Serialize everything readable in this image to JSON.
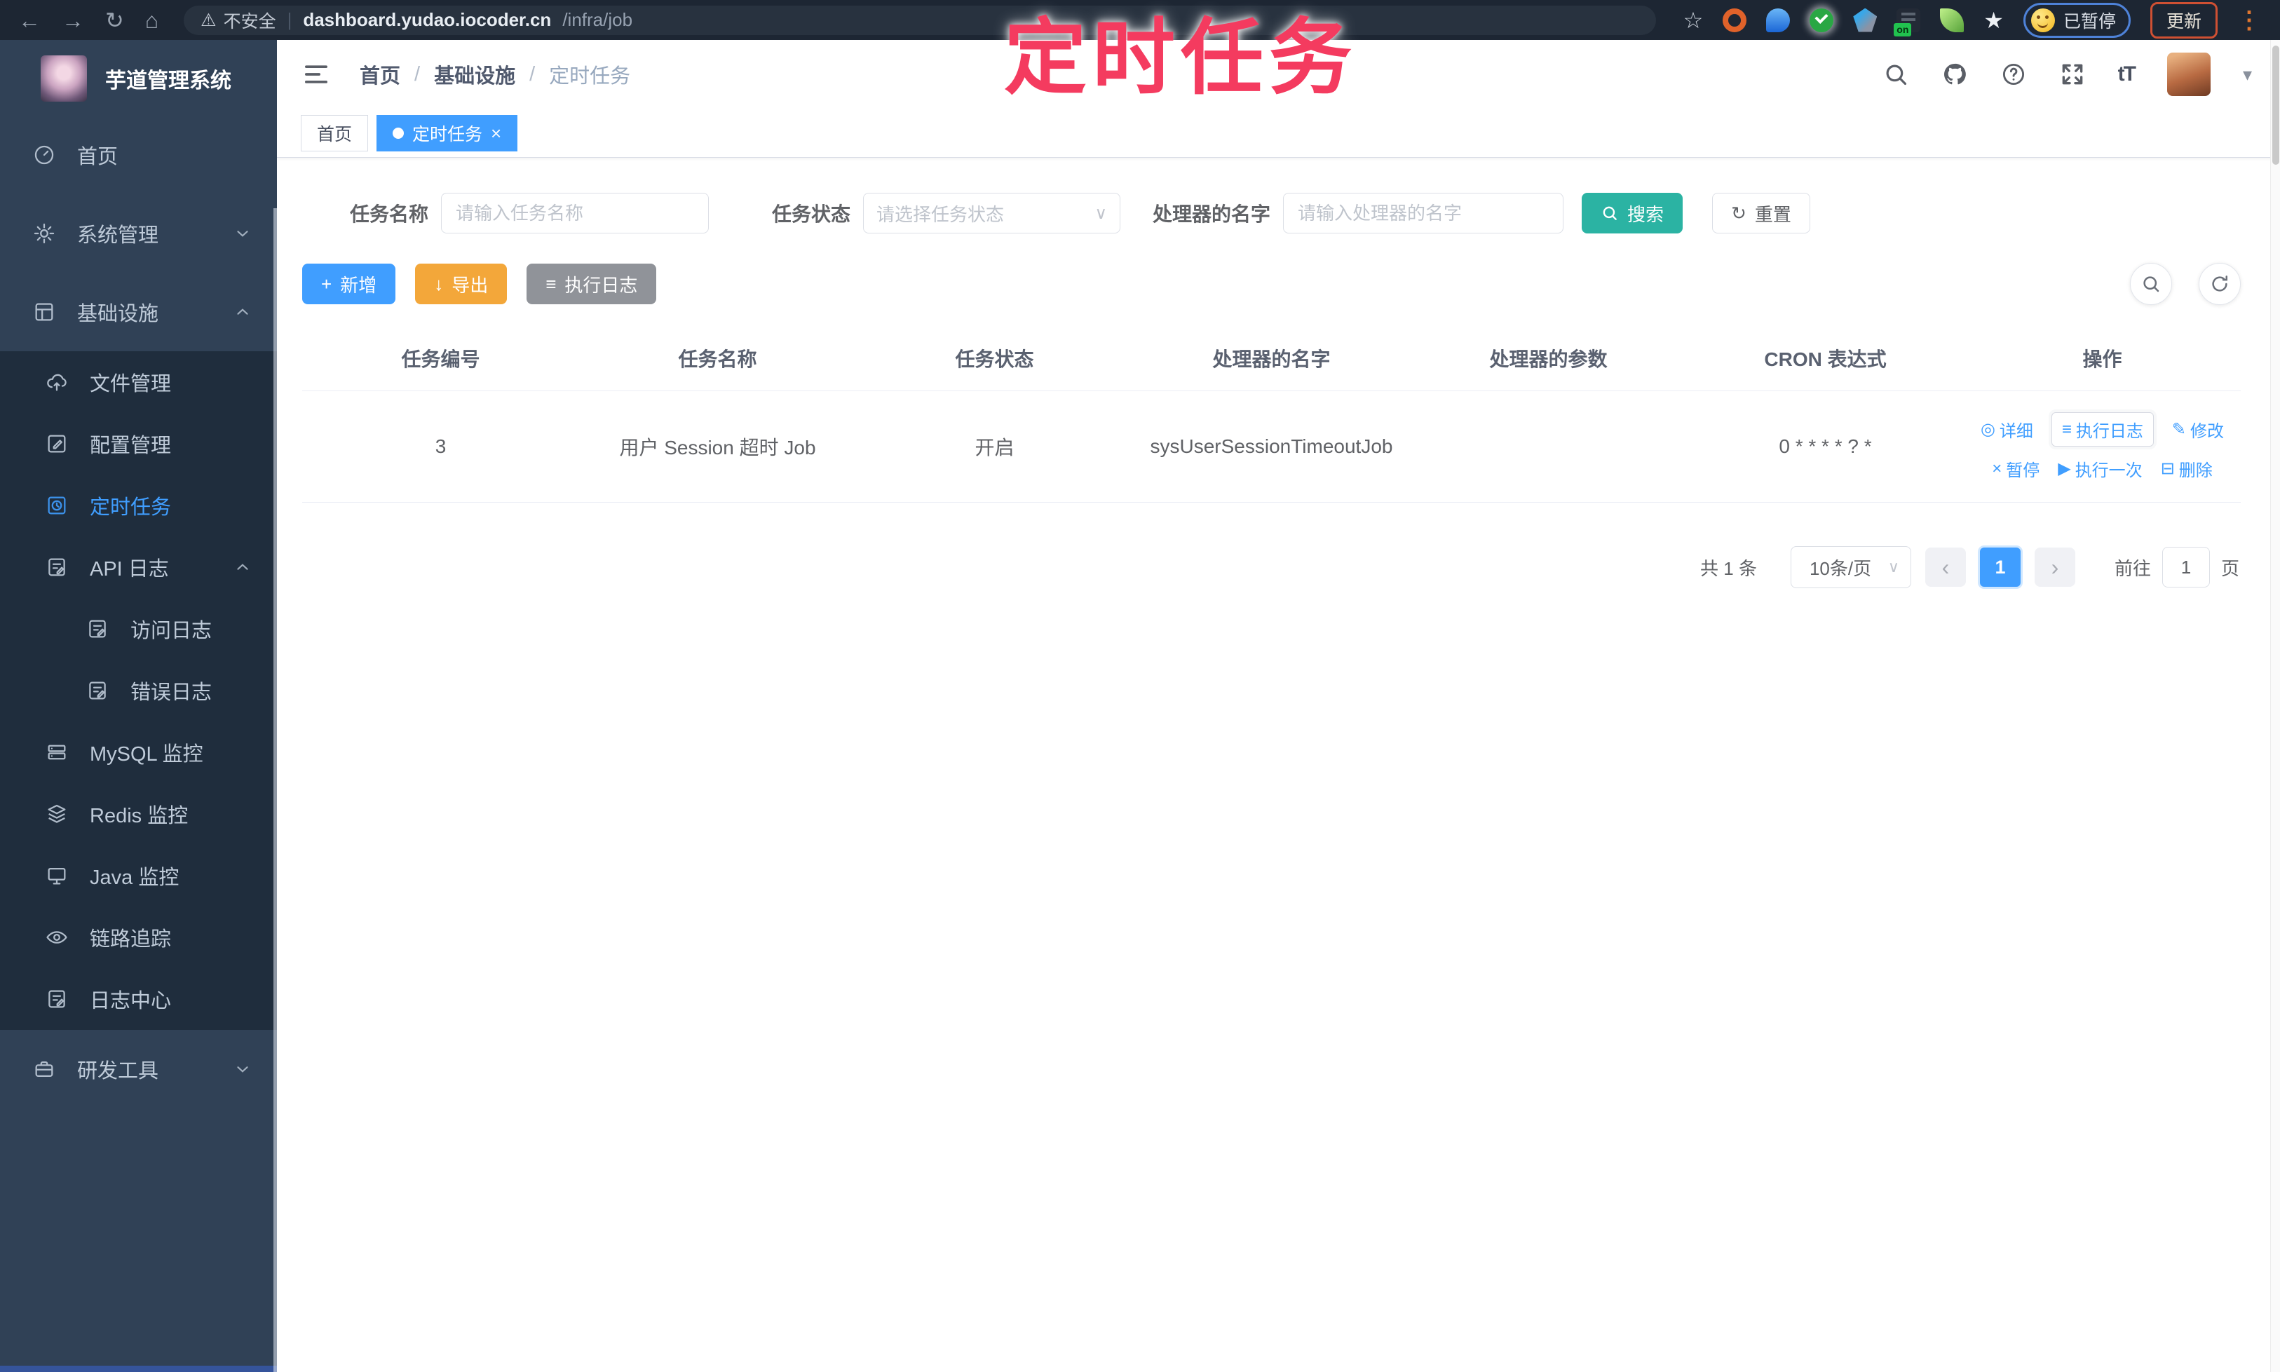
{
  "glyphs": {
    "back": "←",
    "forward": "→",
    "reload": "↻",
    "home": "⌂",
    "warning": "⚠",
    "bookmark_star": "☆",
    "star_filled": "★",
    "overflow_dots": "⋮",
    "url_divider": "|",
    "caret_down": "▾",
    "tab_close": "×",
    "select_chevron": "∨",
    "prev": "‹",
    "next": "›",
    "plus": "+",
    "download": "↓",
    "list": "≡",
    "reset": "↻",
    "font_size": "tT",
    "action_detail": "◎",
    "action_log": "≡",
    "action_edit": "✎",
    "action_pause": "×",
    "action_run": "▶",
    "action_delete": "⊟",
    "onoff_badge": "on"
  },
  "browser": {
    "security_label": "不安全",
    "url_host": "dashboard.yudao.iocoder.cn",
    "url_path": "/infra/job",
    "paused_label": "已暂停",
    "update_label": "更新"
  },
  "annotation": {
    "text": "定时任务",
    "color": "#f43b5f"
  },
  "sidebar": {
    "title": "芋道管理系统",
    "items": [
      {
        "label": "首页"
      },
      {
        "label": "系统管理"
      },
      {
        "label": "基础设施"
      },
      {
        "label": "文件管理"
      },
      {
        "label": "配置管理"
      },
      {
        "label": "定时任务"
      },
      {
        "label": "API 日志"
      },
      {
        "label": "访问日志"
      },
      {
        "label": "错误日志"
      },
      {
        "label": "MySQL 监控"
      },
      {
        "label": "Redis 监控"
      },
      {
        "label": "Java 监控"
      },
      {
        "label": "链路追踪"
      },
      {
        "label": "日志中心"
      },
      {
        "label": "研发工具"
      }
    ]
  },
  "header": {
    "breadcrumb": [
      "首页",
      "基础设施",
      "定时任务"
    ],
    "separator": "/"
  },
  "tabs": [
    {
      "label": "首页"
    },
    {
      "label": "定时任务"
    }
  ],
  "filters": {
    "name_label": "任务名称",
    "name_placeholder": "请输入任务名称",
    "status_label": "任务状态",
    "status_placeholder": "请选择任务状态",
    "handler_label": "处理器的名字",
    "handler_placeholder": "请输入处理器的名字",
    "search_label": "搜索",
    "reset_label": "重置"
  },
  "toolbar": {
    "add_label": "新增",
    "export_label": "导出",
    "exec_log_label": "执行日志"
  },
  "table": {
    "columns": [
      "任务编号",
      "任务名称",
      "任务状态",
      "处理器的名字",
      "处理器的参数",
      "CRON 表达式",
      "操作"
    ],
    "rows": [
      {
        "id": "3",
        "name": "用户 Session 超时 Job",
        "status": "开启",
        "handler": "sysUserSessionTimeoutJob",
        "params": "",
        "cron": "0 * * * * ? *",
        "actions": [
          {
            "label": "详细"
          },
          {
            "label": "执行日志"
          },
          {
            "label": "修改"
          },
          {
            "label": "暂停"
          },
          {
            "label": "执行一次"
          },
          {
            "label": "删除"
          }
        ]
      }
    ]
  },
  "pagination": {
    "total": "共 1 条",
    "page_size": "10条/页",
    "current_page": "1",
    "goto_label": "前往",
    "page_unit": "页",
    "goto_value": "1"
  },
  "colors": {
    "accent": "#409eff",
    "search_button": "#2bb3a3",
    "export_button": "#f3a73a",
    "info_button": "#909399",
    "sidebar_bg": "#304156",
    "submenu_bg": "#1f2d3d",
    "annotation": "#f43b5f"
  }
}
